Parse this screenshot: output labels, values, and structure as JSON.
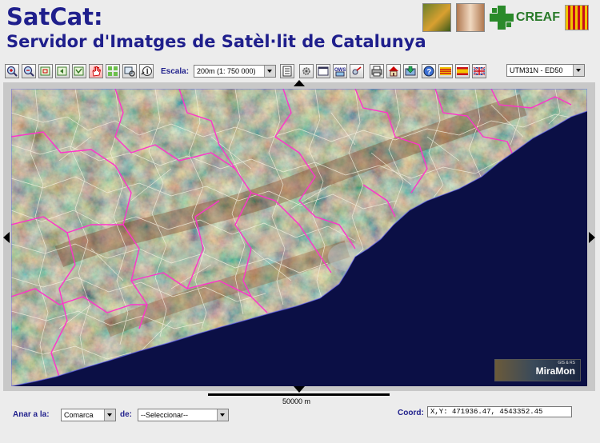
{
  "header": {
    "title": "SatCat:",
    "subtitle": "Servidor d'Imatges de Satèl·lit de Catalunya",
    "creaf_logo_text": "CREAF"
  },
  "toolbar": {
    "escala_label": "Escala:",
    "escala_value": "200m (1: 750 000)",
    "projection_value": "UTM31N - ED50"
  },
  "map": {
    "scale_text": "50000 m",
    "watermark_text": "MiraMon",
    "watermark_small": "GIS & RS",
    "sea_color": "#0b0f45",
    "land_color": "#6e6244",
    "border_comarca_color": "#ff33cc",
    "border_municipi_color": "#f4f0e0"
  },
  "footer": {
    "anar_label": "Anar a la:",
    "anar_value": "Comarca",
    "de_label": "de:",
    "de_value": "--Seleccionar--",
    "coord_label": "Coord:",
    "coord_value": "X,Y: 471936.47, 4543352.45"
  }
}
